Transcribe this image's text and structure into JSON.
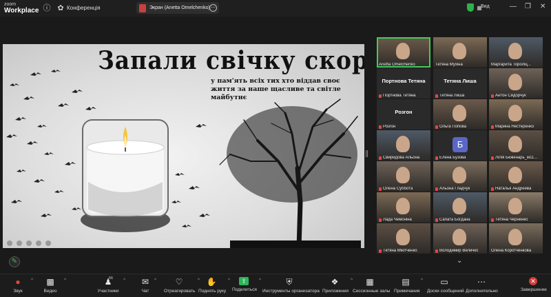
{
  "app": {
    "brand_line1": "zoom",
    "brand_line2": "Workplace"
  },
  "titlebar": {
    "meeting_label": "Конференція",
    "share_pill_text": "Экран (Anetta Omelchenko)",
    "view_label": "Вид"
  },
  "shared_screen": {
    "title": "Запали свічку скорботи",
    "subtitle": "у пам'ять всіх тих хто віддав своє життя за наше щасливе та світле майбутнє"
  },
  "participants": [
    {
      "name": "Anetta Omelchenko",
      "kind": "video",
      "muted": false,
      "active": true
    },
    {
      "name": "Тетяна Мухіна",
      "kind": "video",
      "muted": false
    },
    {
      "name": "Маргарита Тороліц...",
      "kind": "video",
      "muted": false
    },
    {
      "name": "Портнова Тетяна",
      "kind": "name",
      "big_label": "Портнова Тетяна",
      "muted": true
    },
    {
      "name": "Тетяна Лиша",
      "kind": "name",
      "big_label": "Тетяна Лиша",
      "muted": true
    },
    {
      "name": "Антон Сидорчук",
      "kind": "video",
      "muted": true
    },
    {
      "name": "Розгон",
      "kind": "name",
      "big_label": "Розгон",
      "muted": true
    },
    {
      "name": "Ольга Попова",
      "kind": "video",
      "muted": true
    },
    {
      "name": "Марина Нестеренко",
      "kind": "video",
      "muted": true
    },
    {
      "name": "Свиридова Альона",
      "kind": "video",
      "muted": true
    },
    {
      "name": "Елена Бузова",
      "kind": "avatar",
      "avatar_letter": "Б",
      "muted": true
    },
    {
      "name": "Лілія Беженарь_м11...",
      "kind": "video",
      "muted": true
    },
    {
      "name": "Олена Субботa",
      "kind": "video",
      "muted": true
    },
    {
      "name": "Альона Гладчук",
      "kind": "video",
      "muted": true
    },
    {
      "name": "Наталья Андреева",
      "kind": "video",
      "muted": true
    },
    {
      "name": "Лада Чемоніна",
      "kind": "video",
      "muted": true
    },
    {
      "name": "Сапата Богдана",
      "kind": "video",
      "muted": true
    },
    {
      "name": "Тетяна Черненко",
      "kind": "video",
      "muted": true
    },
    {
      "name": "Тетяна Мікітченко",
      "kind": "video",
      "muted": true
    },
    {
      "name": "Володимир Величко",
      "kind": "video",
      "muted": true
    },
    {
      "name": "Олена Коротченкова",
      "kind": "video",
      "muted": false
    }
  ],
  "toolbar": {
    "mute": "Звук",
    "video": "Видео",
    "participants": "Участники",
    "participants_count": "66",
    "chat": "Чат",
    "react": "Отреагировать",
    "raise_hand": "Поднять руку",
    "share": "Поделиться",
    "host_tools": "Инструменты организатора",
    "apps": "Приложения",
    "breakout": "Сессионные залы",
    "notes": "Примечания",
    "whiteboard": "Доски сообщений",
    "more": "Дополнительно",
    "end": "Завершение"
  },
  "colors": {
    "active_speaker": "#3ecf5a",
    "end_red": "#d23c3c",
    "share_green": "#2eb45b",
    "avatar_blue": "#5a67c7"
  }
}
